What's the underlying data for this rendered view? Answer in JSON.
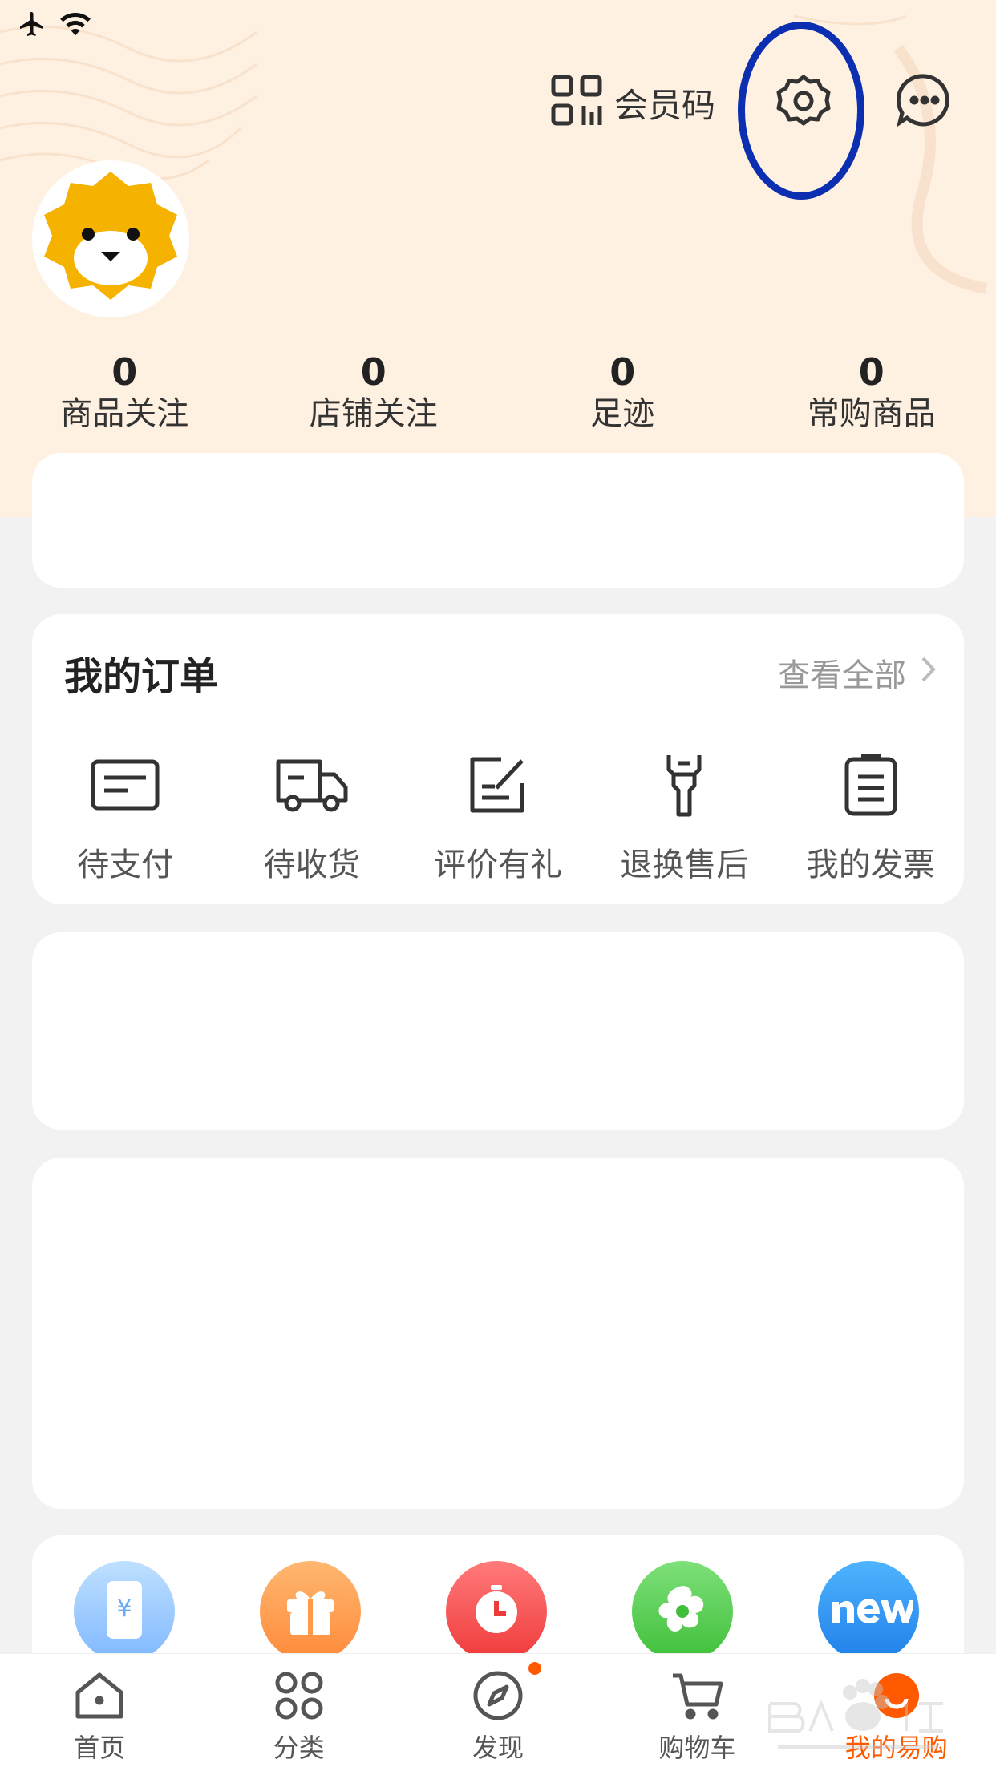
{
  "header": {
    "member_code_label": "会员码"
  },
  "stats": [
    {
      "value": "0",
      "label": "商品关注"
    },
    {
      "value": "0",
      "label": "店铺关注"
    },
    {
      "value": "0",
      "label": "足迹"
    },
    {
      "value": "0",
      "label": "常购商品"
    }
  ],
  "orders": {
    "title": "我的订单",
    "view_all": "查看全部",
    "items": [
      {
        "label": "待支付",
        "icon": "payment-icon"
      },
      {
        "label": "待收货",
        "icon": "truck-icon"
      },
      {
        "label": "评价有礼",
        "icon": "review-icon"
      },
      {
        "label": "退换售后",
        "icon": "wrench-icon"
      },
      {
        "label": "我的发票",
        "icon": "invoice-icon"
      }
    ]
  },
  "tabbar": {
    "items": [
      {
        "label": "首页",
        "icon": "home-icon"
      },
      {
        "label": "分类",
        "icon": "category-icon"
      },
      {
        "label": "发现",
        "icon": "compass-icon"
      },
      {
        "label": "购物车",
        "icon": "cart-icon"
      },
      {
        "label": "我的易购",
        "icon": "profile-icon"
      }
    ],
    "active_index": 4
  },
  "colors": {
    "accent": "#ff5a00",
    "header_bg": "#fff1e2",
    "highlight_ring": "#0b2fb0",
    "avatar_yellow": "#f5b300"
  }
}
